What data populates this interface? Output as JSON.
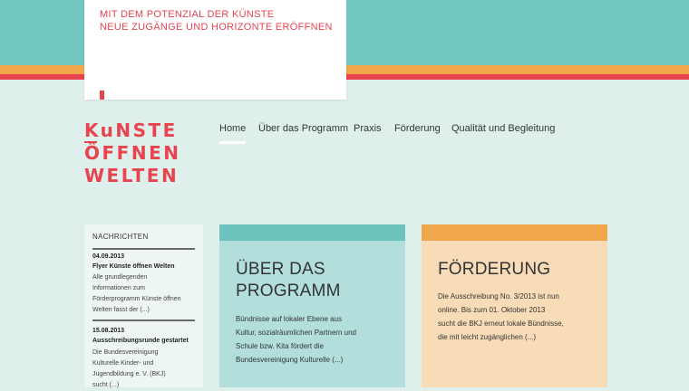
{
  "header": {
    "tagline_line1": "MIT DEM POTENZIAL DER KÜNSTE",
    "tagline_line2": "NEUE ZUGÄNGE UND HORIZONTE ERÖFFNEN"
  },
  "logo": {
    "line1": "KuNSTE",
    "line2": "ÖFFNEN",
    "line3": "WELTEN"
  },
  "nav": {
    "items": [
      {
        "label": "Home",
        "active": true
      },
      {
        "label": "Über das Programm"
      },
      {
        "label": "Praxis"
      },
      {
        "label": "Förderung"
      },
      {
        "label": "Qualität und Begleitung"
      }
    ]
  },
  "news": {
    "heading": "NACHRICHTEN",
    "items": [
      {
        "date": "04.09.2013",
        "title": "Flyer Künste öffnen Welten",
        "lines": [
          "Alle grundlegenden",
          "Informationen zum",
          "Förderprogramm Künste öffnen",
          "Welten fasst der (...)"
        ]
      },
      {
        "date": "15.08.2013",
        "title": "Ausschreibungsrunde gestartet",
        "lines": [
          "Die Bundesvereinigung",
          "Kulturelle Kinder- und",
          "Jugendbildung e. V. (BKJ)",
          "sucht (...)"
        ]
      }
    ]
  },
  "cards": [
    {
      "title_line1": "ÜBER DAS",
      "title_line2": "PROGRAMM",
      "text_lines": [
        "Bündnisse auf lokaler Ebene aus",
        "Kultur, sozialräumlichen Partnern und",
        "Schule bzw. Kita fördert die",
        "Bundesvereinigung Kulturelle (...)"
      ]
    },
    {
      "title_line1": "FÖRDERUNG",
      "text_lines": [
        "Die Ausschreibung No. 3/2013 ist nun",
        "online. Bis zum 01. Oktober 2013",
        "sucht die BKJ erneut lokale Bündnisse,",
        "die mit leicht zugänglichen (...)"
      ]
    }
  ],
  "colors": {
    "teal": "#72c6c2",
    "orange": "#f0a64a",
    "red": "#e8434f",
    "background": "#dff0ec"
  }
}
